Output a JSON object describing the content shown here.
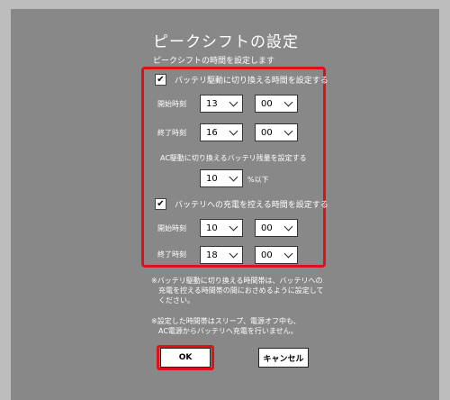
{
  "dialog": {
    "title": "ピークシフトの設定",
    "subtitle": "ピークシフトの時間を設定します"
  },
  "battery_drive": {
    "checkbox_label": "バッテリ駆動に切り換える時間を設定する",
    "checked": true,
    "start_label": "開始時刻",
    "start_hour": "13",
    "start_minute": "00",
    "end_label": "終了時刻",
    "end_hour": "16",
    "end_minute": "00",
    "switch_label": "AC駆動に切り換えるバッテリ残量を設定する",
    "percent_value": "10",
    "percent_suffix": "%以下"
  },
  "charge_control": {
    "checkbox_label": "バッテリへの充電を控える時間を設定する",
    "checked": true,
    "start_label": "開始時刻",
    "start_hour": "10",
    "start_minute": "00",
    "end_label": "終了時刻",
    "end_hour": "18",
    "end_minute": "00"
  },
  "notes": {
    "note1_line1": "※バッテリ駆動に切り換える時間帯は、バッテリへの",
    "note1_line2": "充電を控える時間帯の間におさめるように設定して",
    "note1_line3": "ください。",
    "note2_line1": "※設定した時間帯はスリープ、電源オフ中も、",
    "note2_line2": "AC電源からバッテリへ充電を行いません。"
  },
  "buttons": {
    "ok_label": "OK",
    "cancel_label": "キャンセル"
  },
  "colors": {
    "panel": "#888888",
    "highlight": "#e0101a"
  },
  "icons": {
    "check": "checkmark-icon",
    "dropdown": "chevron-down-icon"
  }
}
